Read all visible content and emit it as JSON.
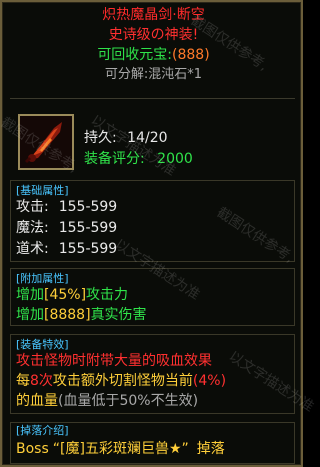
{
  "item": {
    "name": "炽热魔晶剑·断空",
    "rarity": "史诗级の神装!",
    "recycle_label": "可回收元宝:",
    "recycle_value": "(888)",
    "decompose": "可分解:混沌石*1",
    "durability_label": "持久:",
    "durability_value": "14/20",
    "score_label": "装备评分:",
    "score_value": "2000"
  },
  "base_attrs": {
    "title": "[基础属性]",
    "rows": [
      {
        "label": "攻击:",
        "value": "155-599"
      },
      {
        "label": "魔法:",
        "value": "155-599"
      },
      {
        "label": "道术:",
        "value": "155-599"
      }
    ]
  },
  "extra_attrs": {
    "title": "[附加属性]",
    "rows": [
      {
        "prefix": "增加",
        "bracket": "[45%]",
        "suffix": "攻击力"
      },
      {
        "prefix": "增加",
        "bracket": "[8888]",
        "suffix": "真实伤害"
      }
    ]
  },
  "special": {
    "title": "[装备特效]",
    "line1": "攻击怪物时附带大量的吸血效果",
    "line2_a": "每",
    "line2_b": "8次",
    "line2_c": "攻击额外切割怪物当前",
    "line2_d": "(4%)",
    "line3_a": "的血量",
    "line3_b": "(血量低于50%不生效)"
  },
  "drop": {
    "title": "[掉落介绍]",
    "boss_prefix": "Boss",
    "boss_quote_open": "“",
    "boss_name": "[魔]五彩斑斓巨兽★",
    "boss_quote_close": "”",
    "boss_suffix": "掉落"
  },
  "watermarks": {
    "a": "截图仅供参考,",
    "b": "截图仅供参考,",
    "c": "以文字描述为准",
    "d": "以文字描述为准",
    "e": "截图仅供参考,",
    "f": "以文字描述为准"
  },
  "colors": {
    "name_red": "#ff2b2b",
    "rarity_red": "#ff3030",
    "gold": "#ffcf3a",
    "orange": "#ff7a2a",
    "green": "#2fe34a",
    "cyan": "#49c6ff",
    "white": "#e9e9e9",
    "gray": "#a8a8a8"
  }
}
